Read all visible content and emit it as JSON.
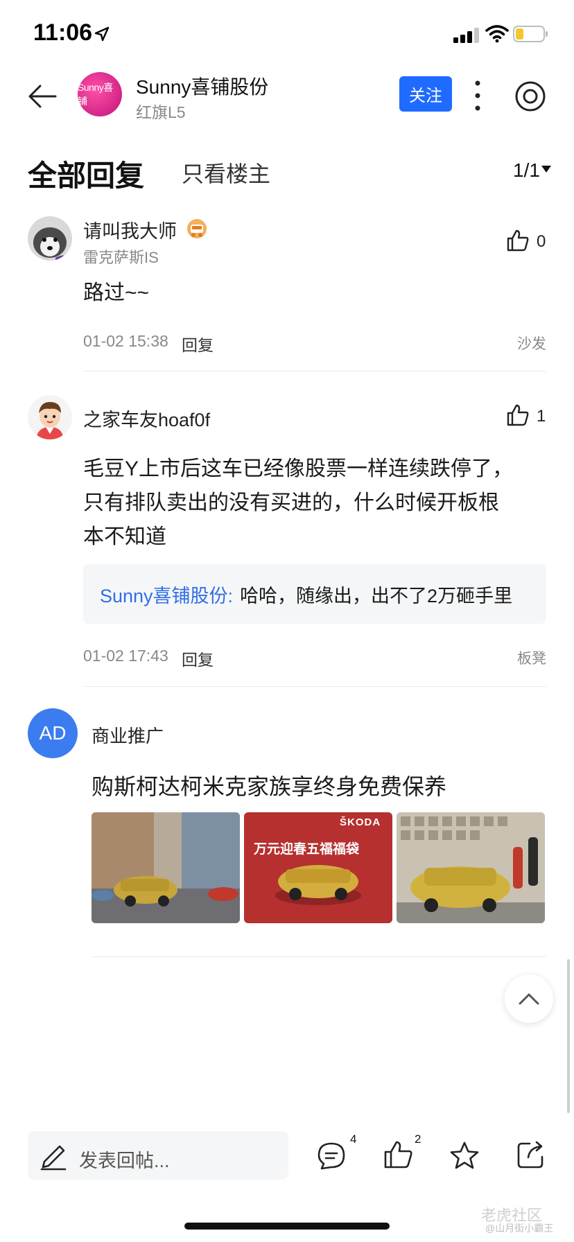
{
  "status": {
    "time": "11:06"
  },
  "header": {
    "avatar_text": "Sunny喜铺",
    "title": "Sunny喜铺股份",
    "subtitle": "红旗L5",
    "follow_label": "关注"
  },
  "tabs": {
    "all": "全部回复",
    "op_only": "只看楼主",
    "page": "1/1"
  },
  "comments": [
    {
      "name": "请叫我大师",
      "sub": "雷克萨斯IS",
      "likes": "0",
      "body": "路过~~",
      "time": "01-02 15:38",
      "reply_label": "回复",
      "floor": "沙发"
    },
    {
      "name": "之家车友hoaf0f",
      "likes": "1",
      "body_lines": [
        "毛豆Y上市后这车已经像股票一样连续跌停了，",
        "只有排队卖出的没有买进的，什么时候开板根",
        "本不知道"
      ],
      "quote_author": "Sunny喜铺股份:",
      "quote_text": "哈哈，随缘出，出不了2万砸手里",
      "time": "01-02 17:43",
      "reply_label": "回复",
      "floor": "板凳"
    }
  ],
  "ad": {
    "avatar_text": "AD",
    "label": "商业推广",
    "headline": "购斯柯达柯米克家族享终身免费保养",
    "image2_brand": "ŠKODA",
    "image2_caption": "万元迎春五福福袋"
  },
  "bottom_bar": {
    "compose_placeholder": "发表回帖...",
    "comment_count": "4",
    "like_count": "2"
  },
  "watermark": {
    "logo": "老虎社区",
    "handle": "@山月街小霸王"
  },
  "colors": {
    "accent": "#1f6bff",
    "quote_author": "#2f6fe6",
    "ad_avatar": "#3b7cf0"
  }
}
